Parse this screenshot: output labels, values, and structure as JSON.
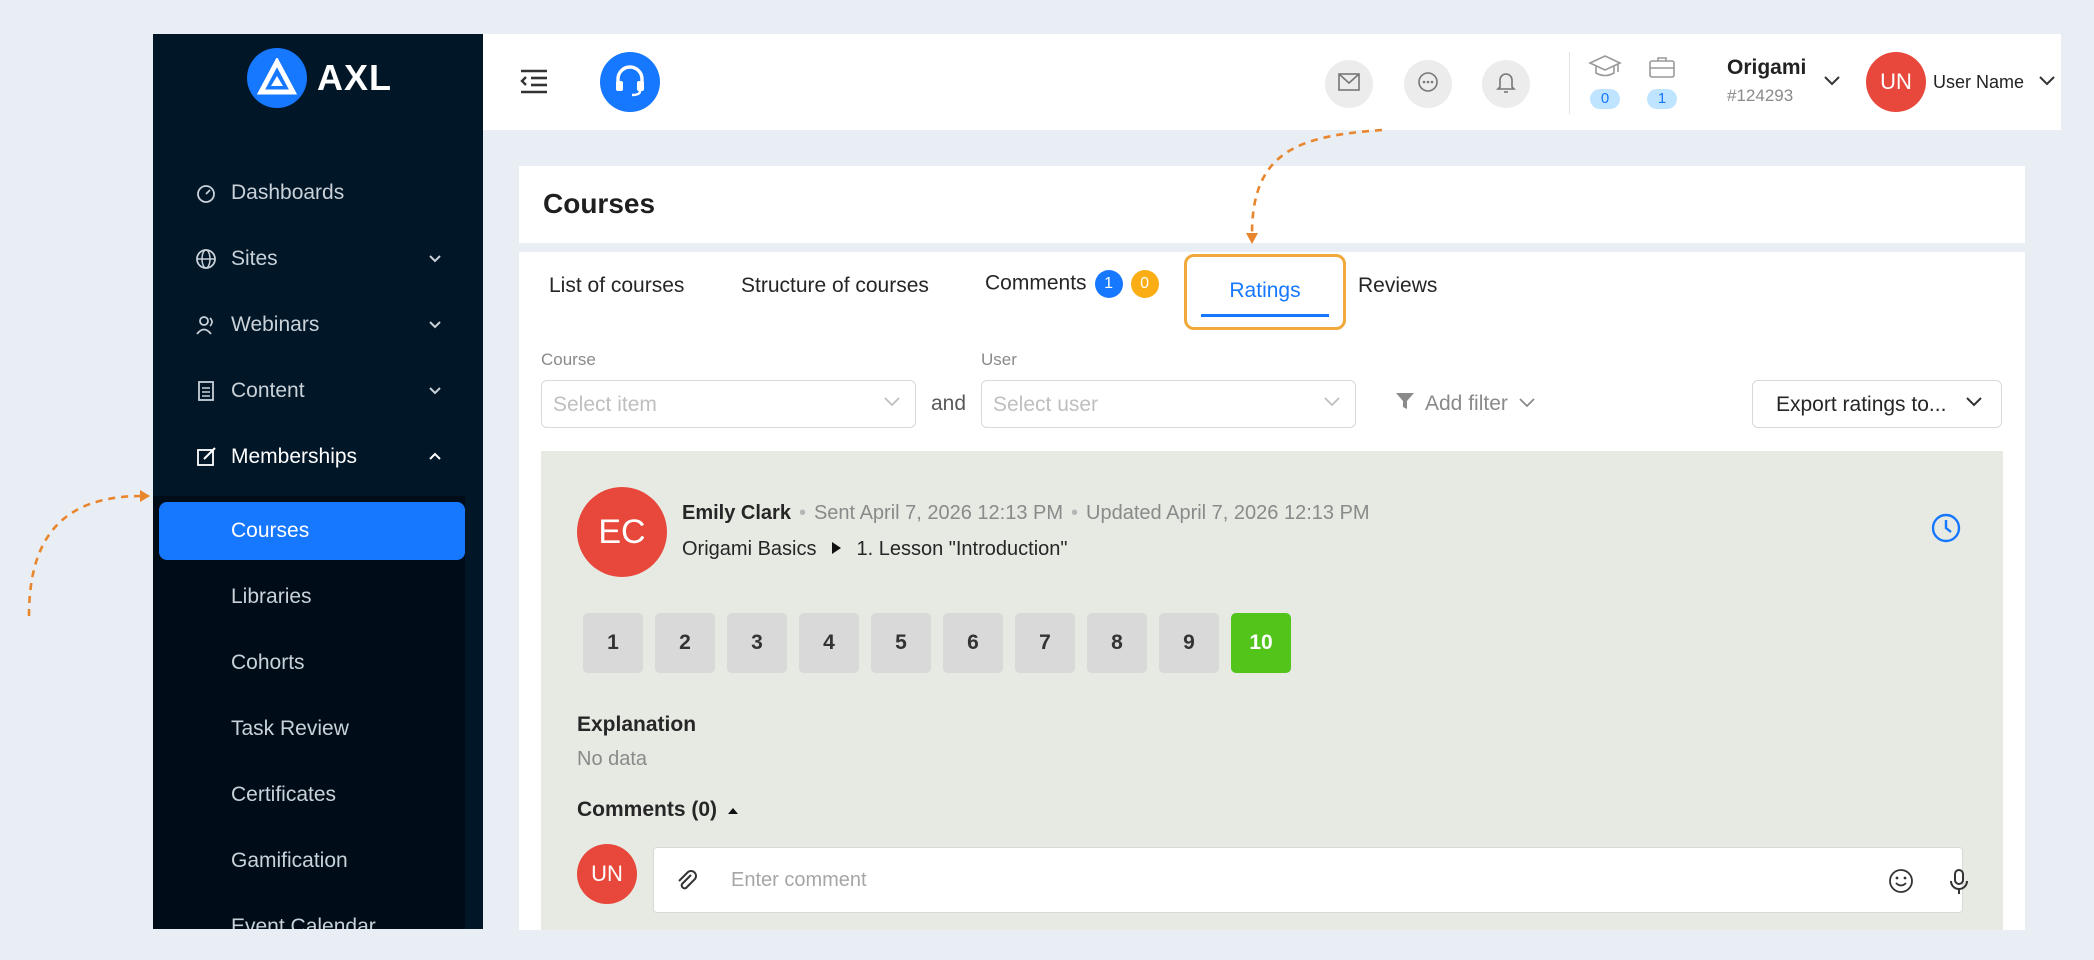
{
  "app": {
    "brand": "AXL",
    "accent_color": "#1677ff",
    "sidebar_bg": "#011627",
    "highlight_color": "#f0a93a"
  },
  "sidebar": {
    "items": [
      {
        "label": "Dashboards",
        "icon": "dashboard-icon"
      },
      {
        "label": "Sites",
        "icon": "globe-icon"
      },
      {
        "label": "Webinars",
        "icon": "webinar-icon"
      },
      {
        "label": "Content",
        "icon": "content-icon"
      },
      {
        "label": "Memberships",
        "icon": "edit-icon"
      }
    ],
    "submenu": [
      {
        "label": "Courses",
        "active": true
      },
      {
        "label": "Libraries"
      },
      {
        "label": "Cohorts"
      },
      {
        "label": "Task Review"
      },
      {
        "label": "Certificates"
      },
      {
        "label": "Gamification"
      },
      {
        "label": "Event Calendar"
      }
    ]
  },
  "header": {
    "courses_count": "0",
    "orders_count": "1",
    "org_name": "Origami",
    "org_id": "#124293",
    "user_initials": "UN",
    "user_name": "User Name"
  },
  "page": {
    "title": "Courses",
    "tabs": [
      {
        "label": "List of courses"
      },
      {
        "label": "Structure of courses"
      },
      {
        "label": "Comments",
        "badge_blue": "1",
        "badge_orange": "0"
      },
      {
        "label": "Ratings",
        "active": true
      },
      {
        "label": "Reviews"
      }
    ]
  },
  "filters": {
    "course_label": "Course",
    "course_placeholder": "Select item",
    "and_word": "and",
    "user_label": "User",
    "user_placeholder": "Select user",
    "add_filter": "Add filter",
    "export": "Export ratings to..."
  },
  "rating": {
    "initials": "EC",
    "author": "Emily Clark",
    "sent": "Sent April 7, 2026 12:13 PM",
    "updated": "Updated April 7, 2026 12:13 PM",
    "course": "Origami Basics",
    "lesson": "1. Lesson \"Introduction\"",
    "scores": [
      "1",
      "2",
      "3",
      "4",
      "5",
      "6",
      "7",
      "8",
      "9",
      "10"
    ],
    "selected_score": "10",
    "explanation_title": "Explanation",
    "explanation_value": "No data",
    "comments_title": "Comments (0)",
    "comment_placeholder": "Enter comment"
  }
}
